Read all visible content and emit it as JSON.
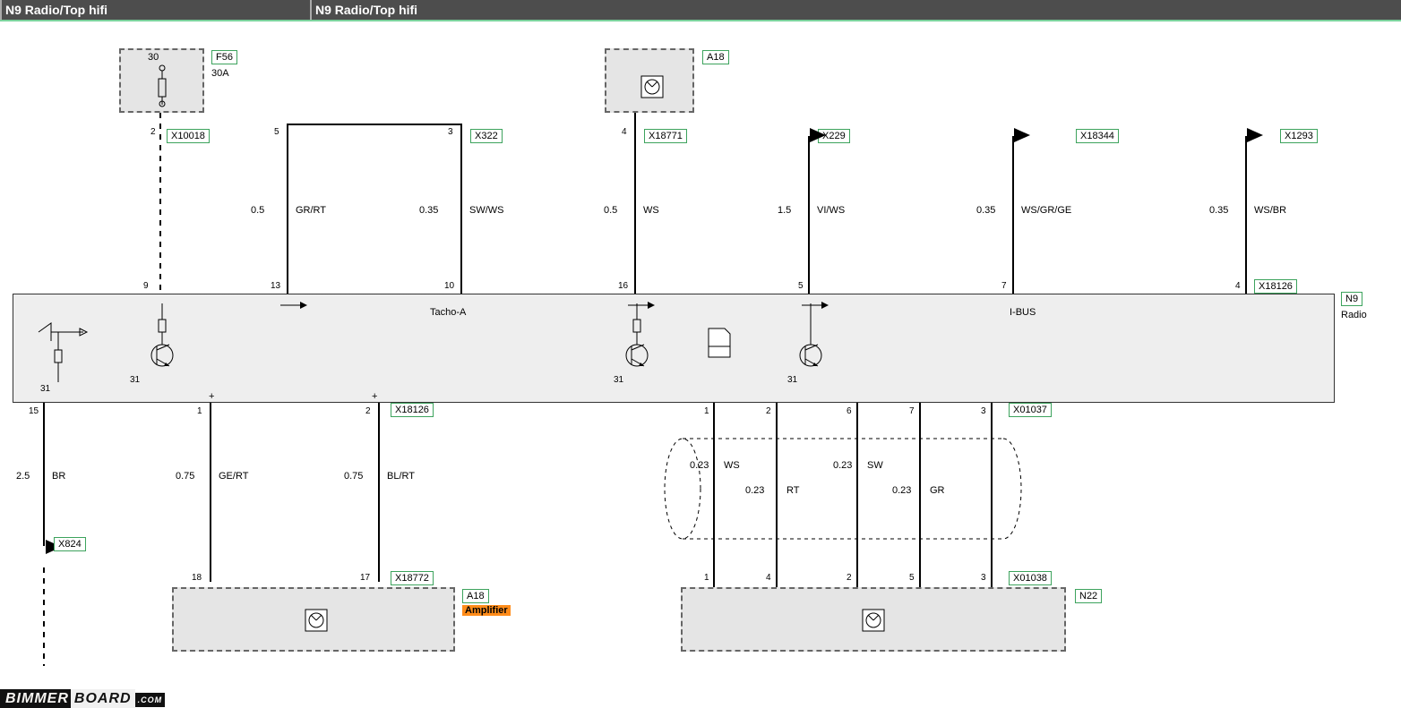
{
  "header": {
    "left": "N9 Radio/Top hifi",
    "right": "N9 Radio/Top hifi"
  },
  "components": {
    "fuse": {
      "id": "F56",
      "rating": "30A",
      "terminal": "30"
    },
    "antenna_top": {
      "id": "A18"
    },
    "amplifier": {
      "id": "A18",
      "name": "Amplifier"
    },
    "n22": {
      "id": "N22"
    },
    "radio": {
      "id": "N9",
      "name": "Radio"
    }
  },
  "connectors": {
    "x10018": "X10018",
    "x322": "X322",
    "x18771": "X18771",
    "x229": "X229",
    "x18344": "X18344",
    "x1293": "X1293",
    "x18126": "X18126",
    "x824": "X824",
    "x18772": "X18772",
    "x01037": "X01037",
    "x01038": "X01038"
  },
  "pins": {
    "p2": "2",
    "p5": "5",
    "p3": "3",
    "p4": "4",
    "p9": "9",
    "p13": "13",
    "p10": "10",
    "p16": "16",
    "p5b": "5",
    "p7": "7",
    "p4b": "4",
    "p15": "15",
    "p1": "1",
    "p2b": "2",
    "p18": "18",
    "p17": "17",
    "p31a": "31",
    "p31b": "31",
    "p31c": "31",
    "p31d": "31",
    "x1037_1": "1",
    "x1037_2": "2",
    "x1037_6": "6",
    "x1037_7": "7",
    "x1037_3": "3",
    "x1038_1": "1",
    "x1038_4": "4",
    "x1038_2": "2",
    "x1038_5": "5",
    "x1038_3": "3"
  },
  "wires": {
    "gr_rt": {
      "size": "0.5",
      "color": "GR/RT"
    },
    "sw_ws": {
      "size": "0.35",
      "color": "SW/WS"
    },
    "ws": {
      "size": "0.5",
      "color": "WS"
    },
    "vi_ws": {
      "size": "1.5",
      "color": "VI/WS"
    },
    "ws_gr_ge": {
      "size": "0.35",
      "color": "WS/GR/GE"
    },
    "ws_br": {
      "size": "0.35",
      "color": "WS/BR"
    },
    "br": {
      "size": "2.5",
      "color": "BR"
    },
    "ge_rt": {
      "size": "0.75",
      "color": "GE/RT"
    },
    "bl_rt": {
      "size": "0.75",
      "color": "BL/RT"
    },
    "shield_ws": {
      "size": "0.23",
      "color": "WS"
    },
    "shield_rt": {
      "size": "0.23",
      "color": "RT"
    },
    "shield_sw": {
      "size": "0.23",
      "color": "SW"
    },
    "shield_gr": {
      "size": "0.23",
      "color": "GR"
    }
  },
  "buses": {
    "tacho": "Tacho-A",
    "ibus": "I-BUS"
  },
  "watermark": {
    "a": "BIMMER",
    "b": "BOARD",
    "c": ".COM"
  }
}
